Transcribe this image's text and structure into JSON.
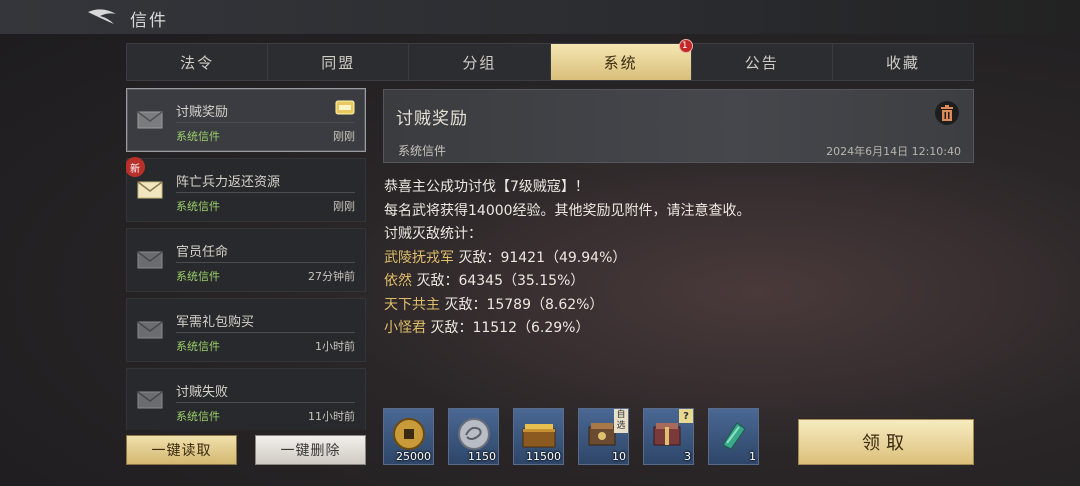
{
  "header": {
    "title": "信件"
  },
  "tabs": [
    {
      "label": "法令"
    },
    {
      "label": "同盟"
    },
    {
      "label": "分组"
    },
    {
      "label": "系统",
      "badge": "1"
    },
    {
      "label": "公告"
    },
    {
      "label": "收藏"
    }
  ],
  "mail_list": [
    {
      "title": "讨贼奖励",
      "category": "系统信件",
      "time": "刚刚"
    },
    {
      "title": "阵亡兵力返还资源",
      "category": "系统信件",
      "time": "刚刚",
      "badge": "新"
    },
    {
      "title": "官员任命",
      "category": "系统信件",
      "time": "27分钟前"
    },
    {
      "title": "军需礼包购买",
      "category": "系统信件",
      "time": "1小时前"
    },
    {
      "title": "讨贼失败",
      "category": "系统信件",
      "time": "11小时前"
    }
  ],
  "actions": {
    "read_all": "一键读取",
    "delete_all": "一键删除"
  },
  "detail": {
    "title": "讨贼奖励",
    "category": "系统信件",
    "date": "2024年6月14日 12:10:40",
    "lines": {
      "l1": "恭喜主公成功讨伐【7级贼寇】！",
      "l2": "每名武将获得14000经验。其他奖励见附件，请注意查收。",
      "l3": "讨贼灭敌统计："
    },
    "stats": [
      {
        "name": "武陵抚戎军",
        "text": " 灭敌：91421（49.94%）"
      },
      {
        "name": "依然",
        "text": " 灭敌：64345（35.15%）"
      },
      {
        "name": "天下共主",
        "text": " 灭敌：15789（8.62%）"
      },
      {
        "name": "小怪君",
        "text": " 灭敌：11512（6.29%）"
      }
    ]
  },
  "rewards": [
    {
      "icon": "copper-coin-icon",
      "qty": "25000"
    },
    {
      "icon": "silver-dragon-coin-icon",
      "qty": "1150"
    },
    {
      "icon": "gold-chest-icon",
      "qty": "11500"
    },
    {
      "icon": "selectable-box-icon",
      "qty": "10",
      "tag": "自选"
    },
    {
      "icon": "mystery-box-icon",
      "qty": "3",
      "tag": "?"
    },
    {
      "icon": "green-cone-icon",
      "qty": "1"
    }
  ],
  "claim_label": "领取",
  "colors": {
    "accent_gold": "#d9bf7a",
    "category_green": "#9bcf6a",
    "highlight_name": "#e0be6a"
  }
}
